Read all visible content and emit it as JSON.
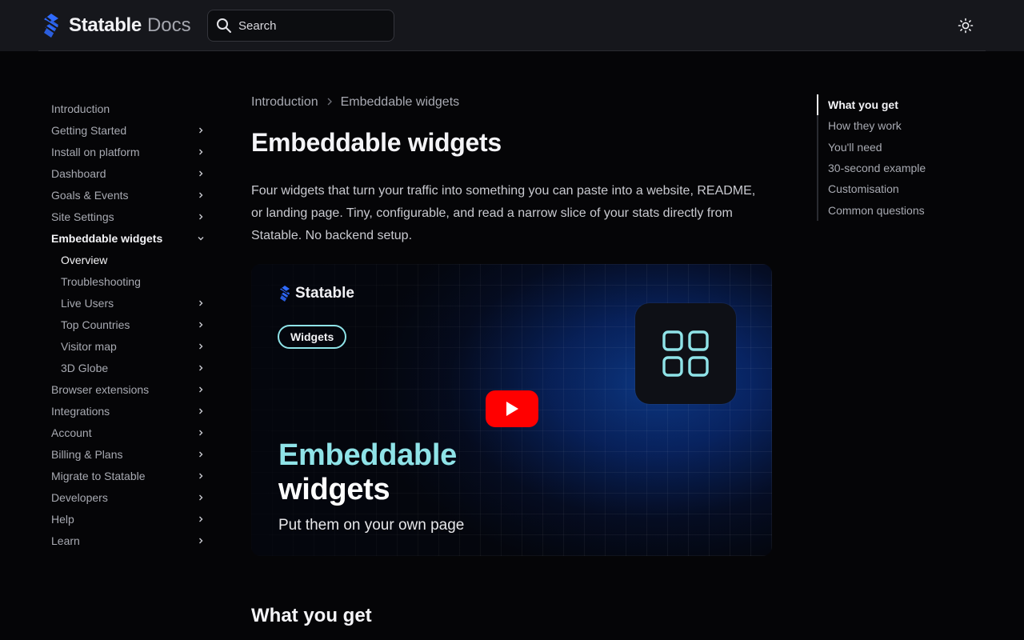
{
  "header": {
    "brand": "Statable",
    "brand_suffix": "Docs",
    "search_placeholder": "Search"
  },
  "sidebar": {
    "items": [
      {
        "label": "Introduction",
        "has_chevron": false
      },
      {
        "label": "Getting Started",
        "has_chevron": true
      },
      {
        "label": "Install on platform",
        "has_chevron": true
      },
      {
        "label": "Dashboard",
        "has_chevron": true
      },
      {
        "label": "Goals & Events",
        "has_chevron": true
      },
      {
        "label": "Site Settings",
        "has_chevron": true
      },
      {
        "label": "Embeddable widgets",
        "has_chevron": true,
        "expanded": true,
        "active": true
      },
      {
        "label": "Overview",
        "sub": true,
        "current": true
      },
      {
        "label": "Troubleshooting",
        "sub": true
      },
      {
        "label": "Live Users",
        "sub": true,
        "has_chevron": true
      },
      {
        "label": "Top Countries",
        "sub": true,
        "has_chevron": true
      },
      {
        "label": "Visitor map",
        "sub": true,
        "has_chevron": true
      },
      {
        "label": "3D Globe",
        "sub": true,
        "has_chevron": true
      },
      {
        "label": "Browser extensions",
        "has_chevron": true
      },
      {
        "label": "Integrations",
        "has_chevron": true
      },
      {
        "label": "Account",
        "has_chevron": true
      },
      {
        "label": "Billing & Plans",
        "has_chevron": true
      },
      {
        "label": "Migrate to Statable",
        "has_chevron": true
      },
      {
        "label": "Developers",
        "has_chevron": true
      },
      {
        "label": "Help",
        "has_chevron": true
      },
      {
        "label": "Learn",
        "has_chevron": true
      }
    ]
  },
  "main": {
    "breadcrumb": [
      "Introduction",
      "Embeddable widgets"
    ],
    "title": "Embeddable widgets",
    "intro": "Four widgets that turn your traffic into something you can paste into a website, README, or landing page. Tiny, configurable, and read a narrow slice of your stats directly from Statable. No backend setup.",
    "video": {
      "brand": "Statable",
      "pill": "Widgets",
      "title_line1": "Embeddable",
      "title_line2": "widgets",
      "subtitle": "Put them on your own page"
    },
    "section_heading": "What you get"
  },
  "toc": {
    "items": [
      "What you get",
      "How they work",
      "You'll need",
      "30-second example",
      "Customisation",
      "Common questions"
    ],
    "active_index": 0
  },
  "colors": {
    "accent": "#8fe3e8",
    "brand_blue": "#2f6bff",
    "play_red": "#ff0000"
  }
}
